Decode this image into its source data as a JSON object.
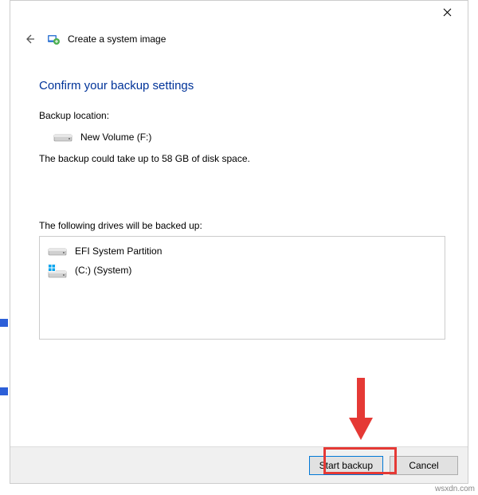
{
  "header": {
    "title": "Create a system image"
  },
  "page": {
    "title": "Confirm your backup settings",
    "backup_location_label": "Backup location:",
    "backup_location_value": "New Volume (F:)",
    "disk_space_text": "The backup could take up to 58 GB of disk space.",
    "drives_label": "The following drives will be backed up:"
  },
  "drives": {
    "efi": "EFI System Partition",
    "system": "(C:) (System)"
  },
  "buttons": {
    "start": "Start backup",
    "cancel": "Cancel"
  },
  "watermark": "wsxdn.com"
}
